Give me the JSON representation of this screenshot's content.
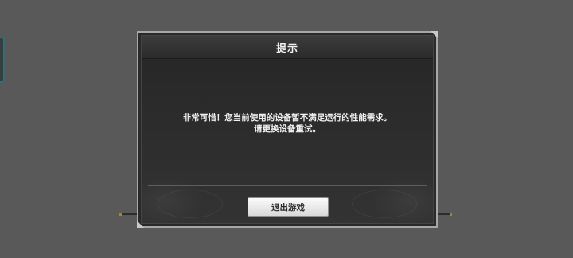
{
  "dialog": {
    "title": "提示",
    "message_line1": "非常可惜！您当前使用的设备暂不满足运行的性能需求。",
    "message_line2": "请更换设备重试。",
    "exit_button_label": "退出游戏"
  },
  "colors": {
    "background": "#595959",
    "dialog_bg": "#2a2a2a",
    "dialog_border": "#a7a7a7",
    "button_bg": "#e8e8e8",
    "text": "#f2f2f2"
  }
}
